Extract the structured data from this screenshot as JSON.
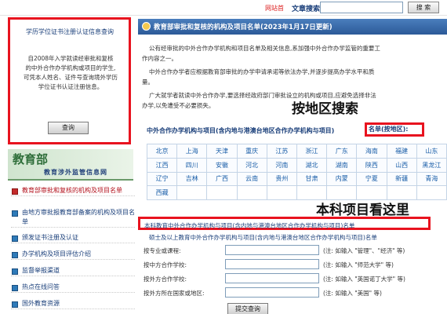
{
  "topbar": {
    "link": "网站首",
    "search_label": "文章搜索",
    "search_button": "搜 索"
  },
  "query_panel": {
    "title": "学历学位证书注册认证信息查询",
    "description": [
      "自2008年入学就读经审批和复核",
      "的中外合作办学机构或项目的学生,",
      "可凭本人姓名、证件号查询境外学历",
      "学位证书认证注册信息。"
    ],
    "button": "查询"
  },
  "moe": {
    "title": "教育部",
    "subtitle": "教育涉外监管信息网"
  },
  "sidebar": {
    "items": [
      {
        "label": "教育部审批和复核的机构及项目名单"
      },
      {
        "label": "由地方审批报教育部备案的机构及项目名单"
      },
      {
        "label": "颁发证书注册及认证"
      },
      {
        "label": "办学机构及项目评估介绍"
      },
      {
        "label": "监督举报渠道"
      },
      {
        "label": "热点在线问答"
      },
      {
        "label": "国外教育资源"
      }
    ]
  },
  "main": {
    "title": "教育部审批和复核的机构及项目名单(2023年1月17日更新)",
    "paragraphs": [
      "公有经审批的中外合作办学机构和项目名单及相关信息,系加强中外合作办学监管的重要工",
      "作内容之一。",
      "中外合作办学者应根据教育部审批的办学申请承诺等依法办学,并逐步提高办学水平和质",
      "量。",
      "广大就学者就读中外合作办学,要选择经政府部门审批设立的机构或项目,应避免选择非法",
      "办学,以免遭受不必要损失。"
    ],
    "coop_link": "中外合作办学机构与项目(含内地与港澳台地区合作办学机构与项目)",
    "region_link": "名单(按地区):",
    "regions": [
      [
        "北京",
        "上海",
        "天津",
        "重庆",
        "江苏",
        "浙江",
        "广东",
        "海南",
        "福建",
        "山东"
      ],
      [
        "江西",
        "四川",
        "安徽",
        "河北",
        "河南",
        "湖北",
        "湖南",
        "陕西",
        "山西",
        "黑龙江"
      ],
      [
        "辽宁",
        "吉林",
        "广西",
        "云南",
        "贵州",
        "甘肃",
        "内蒙",
        "宁夏",
        "新疆",
        "青海"
      ],
      [
        "西藏",
        "",
        "",
        "",
        "",
        "",
        "",
        "",
        "",
        ""
      ]
    ],
    "list_undergrad": "本科教育中外合作办学机构与项目(含内地与港澳台地区合作办学机构与项目)名单",
    "list_above": "硕士及以上教育中外合作办学机构与项目(含内地与港澳台地区合作办学机构与项目)名单",
    "form": [
      {
        "label": "按专业或课程:",
        "hint": "(注: 如输入 \"管理\"、\"经济\" 等)"
      },
      {
        "label": "按中方合作学校:",
        "hint": "(注: 如输入 \"师范大学\" 等)"
      },
      {
        "label": "按外方合作学校:",
        "hint": "(注: 如输入 \"英国诺丁大学\" 等)"
      },
      {
        "label": "按外方所在国家或地区:",
        "hint": "(注: 如输入 \"美国\" 等)"
      }
    ],
    "submit": "提交查询"
  },
  "annotations": {
    "region_search": "按地区搜索",
    "undergrad_here": "本科项目看这里"
  },
  "colors": {
    "highlight_red": "#e8131f",
    "nav_blue": "#1a3f7a",
    "title_bar": "#2c5a98"
  }
}
